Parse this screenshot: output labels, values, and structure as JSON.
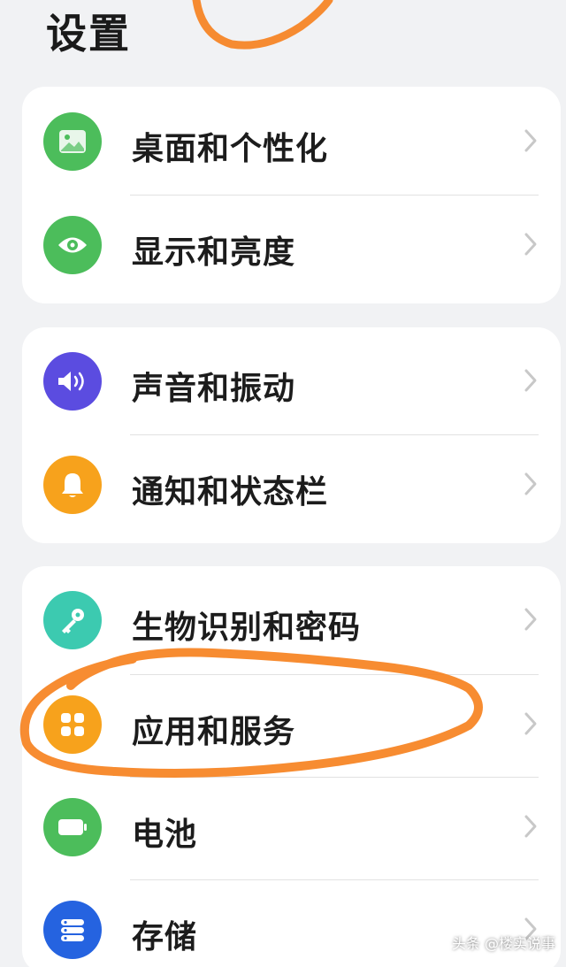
{
  "page": {
    "title": "设置"
  },
  "colors": {
    "green": "#4cbd5b",
    "purple": "#5b4ce0",
    "orange": "#f7a21c",
    "teal": "#3ccab0",
    "blue": "#2563e0",
    "annotation": "#f6821f"
  },
  "groups": [
    {
      "items": [
        {
          "label": "桌面和个性化",
          "icon": "wallpaper-icon"
        },
        {
          "label": "显示和亮度",
          "icon": "eye-icon"
        }
      ]
    },
    {
      "items": [
        {
          "label": "声音和振动",
          "icon": "speaker-icon"
        },
        {
          "label": "通知和状态栏",
          "icon": "bell-icon"
        }
      ]
    },
    {
      "items": [
        {
          "label": "生物识别和密码",
          "icon": "key-icon"
        },
        {
          "label": "应用和服务",
          "icon": "apps-grid-icon"
        },
        {
          "label": "电池",
          "icon": "battery-icon"
        },
        {
          "label": "存储",
          "icon": "storage-icon"
        }
      ]
    }
  ],
  "watermark": "头条 @楼实说事"
}
